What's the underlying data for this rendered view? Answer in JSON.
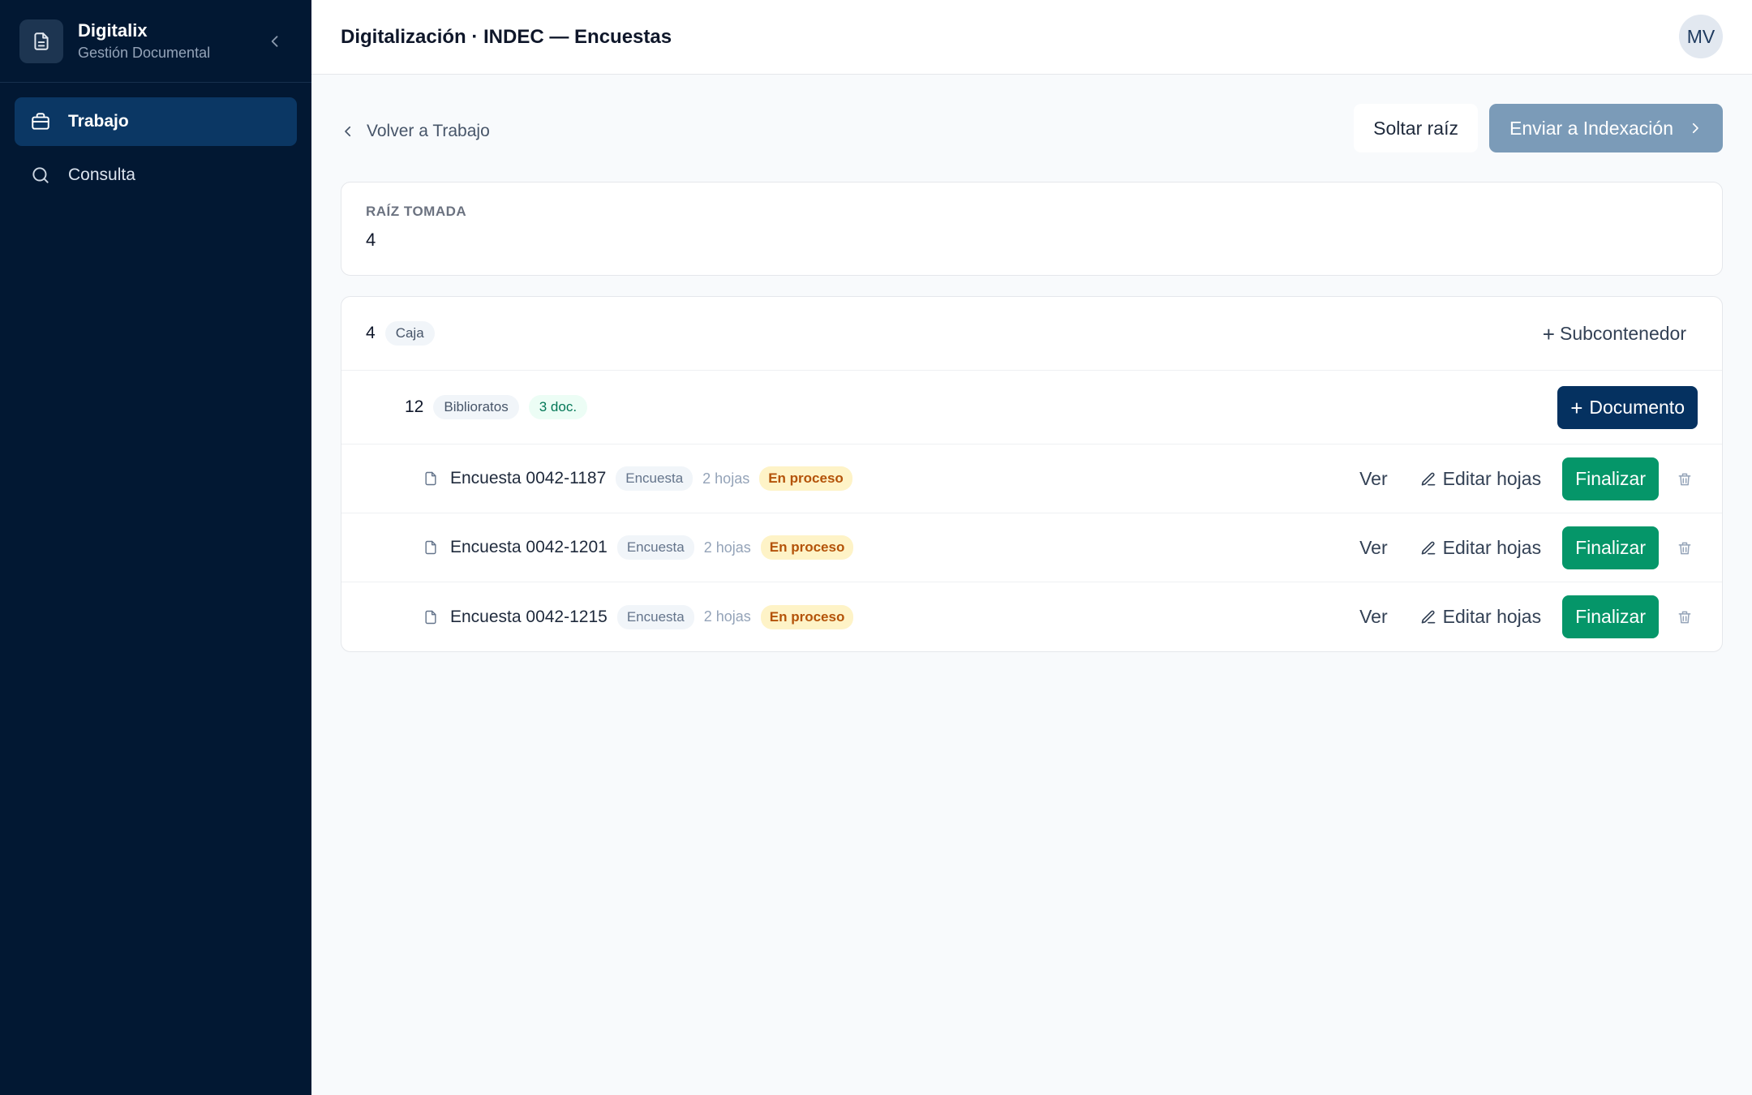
{
  "sidebar": {
    "brand_title": "Digitalix",
    "brand_subtitle": "Gestión Documental",
    "brand_icon": "file-text-icon",
    "items": [
      {
        "label": "Trabajo",
        "icon": "briefcase-icon",
        "active": true
      },
      {
        "label": "Consulta",
        "icon": "search-icon",
        "active": false
      }
    ]
  },
  "header": {
    "title": "Digitalización · INDEC — Encuestas",
    "avatar_initials": "MV"
  },
  "actions": {
    "back_label": "Volver a Trabajo",
    "soltar_label": "Soltar raíz",
    "enviar_label": "Enviar a Indexación"
  },
  "root": {
    "label": "RAÍZ TOMADA",
    "value": "4"
  },
  "tree": {
    "caja": {
      "number": "4",
      "type": "Caja",
      "add_label": "Subcontenedor"
    },
    "biblio": {
      "number": "12",
      "type": "Biblioratos",
      "count_label": "3 doc.",
      "add_label": "Documento"
    },
    "documents": [
      {
        "name": "Encuesta 0042-1187",
        "type": "Encuesta",
        "sheets": "2 hojas",
        "status": "En proceso"
      },
      {
        "name": "Encuesta 0042-1201",
        "type": "Encuesta",
        "sheets": "2 hojas",
        "status": "En proceso"
      },
      {
        "name": "Encuesta 0042-1215",
        "type": "Encuesta",
        "sheets": "2 hojas",
        "status": "En proceso"
      }
    ],
    "doc_actions": {
      "ver": "Ver",
      "editar": "Editar hojas",
      "finalizar": "Finalizar"
    }
  },
  "colors": {
    "sidebar_bg": "#021833",
    "nav_active": "#0b3764",
    "primary": "#053160",
    "success": "#059669",
    "muted_button": "#7b9bb8",
    "warning_bg": "#fef3c7",
    "warning_text": "#b45309"
  }
}
